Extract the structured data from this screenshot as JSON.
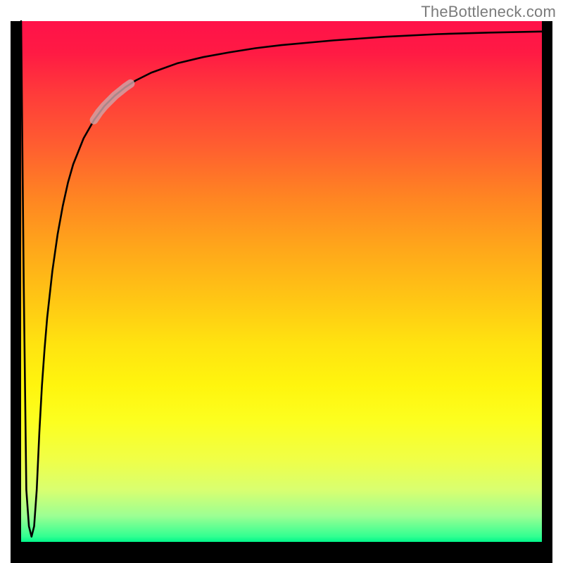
{
  "watermark": "TheBottleneck.com",
  "chart_data": {
    "type": "line",
    "title": "",
    "xlabel": "",
    "ylabel": "",
    "xlim": [
      0,
      100
    ],
    "ylim": [
      0,
      100
    ],
    "grid": false,
    "legend": false,
    "gradient_stops": [
      {
        "pos": 0,
        "color": "#ff1249"
      },
      {
        "pos": 6,
        "color": "#ff1a44"
      },
      {
        "pos": 14,
        "color": "#ff3b3a"
      },
      {
        "pos": 24,
        "color": "#ff5e30"
      },
      {
        "pos": 34,
        "color": "#ff8522"
      },
      {
        "pos": 44,
        "color": "#ffa81a"
      },
      {
        "pos": 54,
        "color": "#ffc814"
      },
      {
        "pos": 62,
        "color": "#ffe310"
      },
      {
        "pos": 70,
        "color": "#fff50e"
      },
      {
        "pos": 77,
        "color": "#fcff20"
      },
      {
        "pos": 84,
        "color": "#f0ff46"
      },
      {
        "pos": 90,
        "color": "#d9ff70"
      },
      {
        "pos": 95,
        "color": "#9cff93"
      },
      {
        "pos": 99,
        "color": "#31ff91"
      },
      {
        "pos": 100,
        "color": "#00f58a"
      }
    ],
    "series": [
      {
        "name": "bottleneck-curve",
        "color": "#000000",
        "x": [
          0.0,
          0.5,
          1.0,
          1.5,
          2.0,
          2.5,
          3.0,
          3.5,
          4.0,
          4.5,
          5.0,
          6.0,
          7.0,
          8.0,
          9.0,
          10.0,
          12.0,
          14.0,
          16.0,
          18.0,
          20.0,
          22.0,
          25.0,
          30.0,
          35.0,
          40.0,
          45.0,
          50.0,
          60.0,
          70.0,
          80.0,
          90.0,
          100.0
        ],
        "y": [
          100.0,
          50.0,
          10.0,
          3.0,
          1.0,
          3.0,
          10.0,
          21.0,
          30.0,
          37.0,
          43.0,
          52.0,
          59.0,
          64.5,
          69.0,
          72.5,
          77.5,
          81.0,
          83.7,
          85.7,
          87.3,
          88.6,
          90.1,
          91.9,
          93.1,
          94.0,
          94.8,
          95.4,
          96.3,
          97.0,
          97.5,
          97.8,
          98.0
        ]
      },
      {
        "name": "highlight-segment",
        "color": "#d0a4a7",
        "thick": true,
        "x": [
          14.0,
          15.0,
          16.0,
          17.0,
          18.0,
          19.0,
          20.0,
          21.0
        ],
        "y": [
          81.0,
          82.5,
          83.7,
          84.7,
          85.7,
          86.5,
          87.3,
          88.0
        ]
      }
    ]
  }
}
